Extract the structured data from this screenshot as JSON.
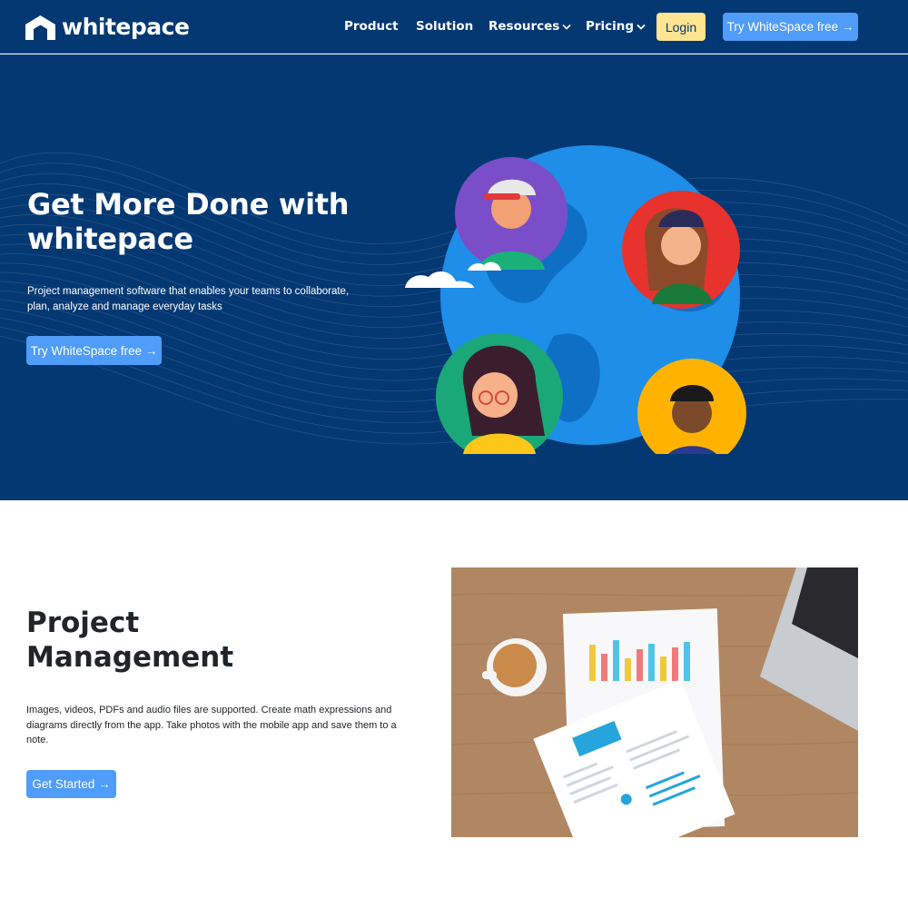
{
  "header": {
    "logo_text": "whitepace",
    "nav": [
      {
        "label": "Product",
        "dropdown": false
      },
      {
        "label": "Solution",
        "dropdown": false
      },
      {
        "label": "Resources",
        "dropdown": true
      },
      {
        "label": "Pricing",
        "dropdown": true
      }
    ],
    "login_label": "Login",
    "try_label": "Try WhiteSpace free →"
  },
  "hero": {
    "title": "Get More Done with whitepace",
    "subtitle": "Project management software that enables your teams to collaborate, plan, analyze and manage everyday tasks",
    "cta_label": "Try WhiteSpace free →"
  },
  "section": {
    "title": "Project Management",
    "description": "Images, videos, PDFs and audio files are supported. Create math expressions and diagrams directly from the app. Take photos with the mobile app and save them to a note.",
    "cta_label": "Get Started →"
  },
  "colors": {
    "brand_dark": "#043873",
    "accent_blue": "#4f9cf9",
    "accent_yellow": "#ffe492"
  },
  "icons": [
    "logo-icon",
    "chevron-down-icon"
  ]
}
